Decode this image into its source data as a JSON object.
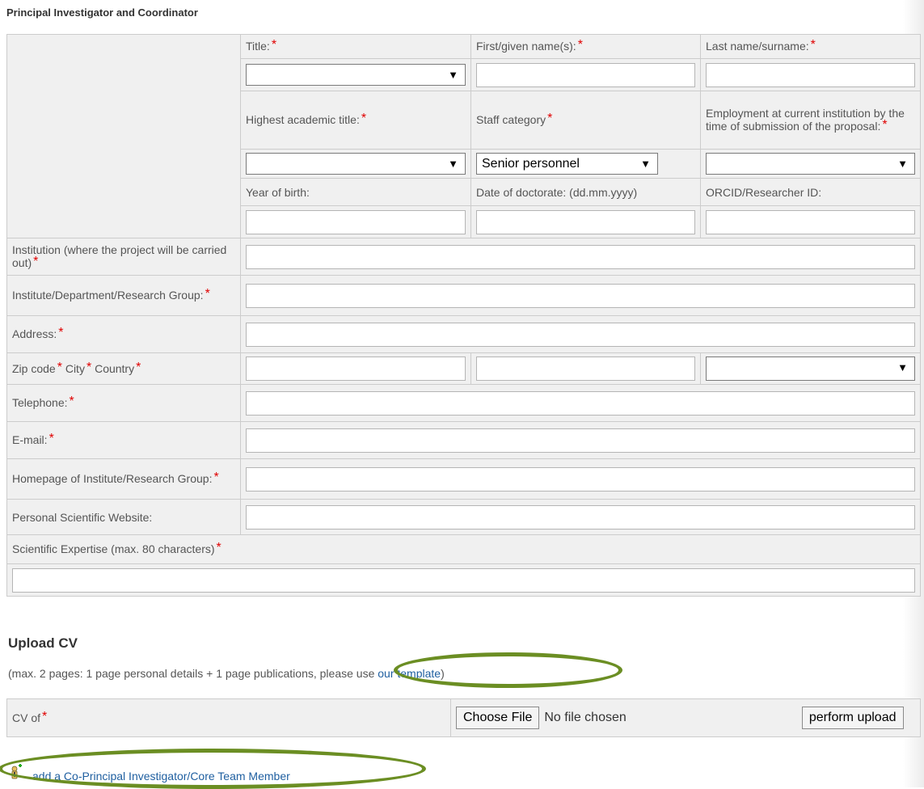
{
  "page": {
    "section_title": "Principal Investigator and Coordinator"
  },
  "required_marker": "*",
  "fields": {
    "title": "Title:",
    "first_name": "First/given name(s):",
    "last_name": "Last name/surname:",
    "academic_title": "Highest academic title:",
    "staff_category": "Staff category",
    "staff_category_value": "Senior personnel",
    "employment": "Employment at current institution by the time of submission of the proposal:",
    "year_of_birth": "Year of birth:",
    "date_of_doctorate": "Date of doctorate: (dd.mm.yyyy)",
    "orcid": "ORCID/Researcher ID:",
    "institution": "Institution (where the project will be carried out)",
    "institute": "Institute/Department/Research Group:",
    "address": "Address:",
    "zip": "Zip code",
    "city": "City",
    "country": "Country",
    "telephone": "Telephone:",
    "email": "E-mail:",
    "homepage": "Homepage of Institute/Research Group:",
    "personal_website": "Personal Scientific Website:",
    "expertise": "Scientific Expertise (max. 80 characters)"
  },
  "upload": {
    "title": "Upload CV",
    "note_prefix": "(max. 2 pages: 1 page personal details + 1 page publications, please use ",
    "template_link": "our template",
    "note_suffix": ")",
    "cv_label": "CV of",
    "choose_file": "Choose File",
    "no_file": "No file chosen",
    "perform_upload": "perform upload"
  },
  "add_member": {
    "label": "add a Co-Principal Investigator/Core Team Member"
  },
  "colors": {
    "accent_link": "#1f5fa0",
    "required": "#e00000",
    "highlight": "#6b8e23"
  }
}
